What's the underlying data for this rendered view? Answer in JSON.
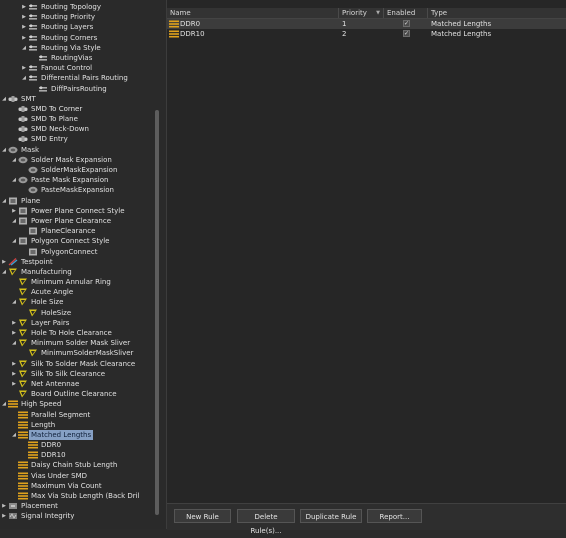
{
  "tree": [
    {
      "label": "Routing Topology",
      "icon": "rule-icon",
      "expander": "collapsed",
      "depth": 3
    },
    {
      "label": "Routing Priority",
      "icon": "rule-icon",
      "expander": "collapsed",
      "depth": 3
    },
    {
      "label": "Routing Layers",
      "icon": "rule-icon",
      "expander": "collapsed",
      "depth": 3
    },
    {
      "label": "Routing Corners",
      "icon": "rule-icon",
      "expander": "collapsed",
      "depth": 3
    },
    {
      "label": "Routing Via Style",
      "icon": "rule-icon",
      "expander": "expanded",
      "depth": 3
    },
    {
      "label": "RoutingVias",
      "icon": "rule-icon",
      "expander": "none",
      "depth": 4
    },
    {
      "label": "Fanout Control",
      "icon": "rule-icon",
      "expander": "collapsed",
      "depth": 3
    },
    {
      "label": "Differential Pairs Routing",
      "icon": "rule-icon",
      "expander": "expanded",
      "depth": 3
    },
    {
      "label": "DiffPairsRouting",
      "icon": "rule-icon",
      "expander": "none",
      "depth": 4
    },
    {
      "label": "SMT",
      "icon": "smt-icon",
      "expander": "expanded",
      "depth": 1
    },
    {
      "label": "SMD To Corner",
      "icon": "smt-icon",
      "expander": "none",
      "depth": 2
    },
    {
      "label": "SMD To Plane",
      "icon": "smt-icon",
      "expander": "none",
      "depth": 2
    },
    {
      "label": "SMD Neck-Down",
      "icon": "smt-icon",
      "expander": "none",
      "depth": 2
    },
    {
      "label": "SMD Entry",
      "icon": "smt-icon",
      "expander": "none",
      "depth": 2
    },
    {
      "label": "Mask",
      "icon": "mask-icon",
      "expander": "expanded",
      "depth": 1
    },
    {
      "label": "Solder Mask Expansion",
      "icon": "mask-icon",
      "expander": "expanded",
      "depth": 2
    },
    {
      "label": "SolderMaskExpansion",
      "icon": "mask-icon",
      "expander": "none",
      "depth": 3
    },
    {
      "label": "Paste Mask Expansion",
      "icon": "mask-icon",
      "expander": "expanded",
      "depth": 2
    },
    {
      "label": "PasteMaskExpansion",
      "icon": "mask-icon",
      "expander": "none",
      "depth": 3
    },
    {
      "label": "Plane",
      "icon": "plane-icon",
      "expander": "expanded",
      "depth": 1
    },
    {
      "label": "Power Plane Connect Style",
      "icon": "plane-icon",
      "expander": "collapsed",
      "depth": 2
    },
    {
      "label": "Power Plane Clearance",
      "icon": "plane-icon",
      "expander": "expanded",
      "depth": 2
    },
    {
      "label": "PlaneClearance",
      "icon": "plane-icon",
      "expander": "none",
      "depth": 3
    },
    {
      "label": "Polygon Connect Style",
      "icon": "plane-icon",
      "expander": "expanded",
      "depth": 2
    },
    {
      "label": "PolygonConnect",
      "icon": "plane-icon",
      "expander": "none",
      "depth": 3
    },
    {
      "label": "Testpoint",
      "icon": "testpoint-icon",
      "expander": "collapsed",
      "depth": 1
    },
    {
      "label": "Manufacturing",
      "icon": "manufacturing-icon",
      "expander": "expanded",
      "depth": 1
    },
    {
      "label": "Minimum Annular Ring",
      "icon": "manufacturing-icon",
      "expander": "none",
      "depth": 2
    },
    {
      "label": "Acute Angle",
      "icon": "manufacturing-icon",
      "expander": "none",
      "depth": 2
    },
    {
      "label": "Hole Size",
      "icon": "manufacturing-icon",
      "expander": "expanded",
      "depth": 2
    },
    {
      "label": "HoleSize",
      "icon": "manufacturing-icon",
      "expander": "none",
      "depth": 3
    },
    {
      "label": "Layer Pairs",
      "icon": "manufacturing-icon",
      "expander": "collapsed",
      "depth": 2
    },
    {
      "label": "Hole To Hole Clearance",
      "icon": "manufacturing-icon",
      "expander": "collapsed",
      "depth": 2
    },
    {
      "label": "Minimum Solder Mask Sliver",
      "icon": "manufacturing-icon",
      "expander": "expanded",
      "depth": 2
    },
    {
      "label": "MinimumSolderMaskSliver",
      "icon": "manufacturing-icon",
      "expander": "none",
      "depth": 3
    },
    {
      "label": "Silk To Solder Mask Clearance",
      "icon": "manufacturing-icon",
      "expander": "collapsed",
      "depth": 2
    },
    {
      "label": "Silk To Silk Clearance",
      "icon": "manufacturing-icon",
      "expander": "collapsed",
      "depth": 2
    },
    {
      "label": "Net Antennae",
      "icon": "manufacturing-icon",
      "expander": "collapsed",
      "depth": 2
    },
    {
      "label": "Board Outline Clearance",
      "icon": "manufacturing-icon",
      "expander": "none",
      "depth": 2
    },
    {
      "label": "High Speed",
      "icon": "highspeed-icon",
      "expander": "expanded",
      "depth": 1
    },
    {
      "label": "Parallel Segment",
      "icon": "highspeed-icon",
      "expander": "none",
      "depth": 2
    },
    {
      "label": "Length",
      "icon": "highspeed-icon",
      "expander": "none",
      "depth": 2
    },
    {
      "label": "Matched Lengths",
      "icon": "highspeed-icon",
      "expander": "expanded",
      "depth": 2,
      "selected": true
    },
    {
      "label": "DDR0",
      "icon": "highspeed-icon",
      "expander": "none",
      "depth": 3
    },
    {
      "label": "DDR10",
      "icon": "highspeed-icon",
      "expander": "none",
      "depth": 3
    },
    {
      "label": "Daisy Chain Stub Length",
      "icon": "highspeed-icon",
      "expander": "none",
      "depth": 2
    },
    {
      "label": "Vias Under SMD",
      "icon": "highspeed-icon",
      "expander": "none",
      "depth": 2
    },
    {
      "label": "Maximum Via Count",
      "icon": "highspeed-icon",
      "expander": "none",
      "depth": 2
    },
    {
      "label": "Max Via Stub Length (Back Dril",
      "icon": "highspeed-icon",
      "expander": "none",
      "depth": 2
    },
    {
      "label": "Placement",
      "icon": "placement-icon",
      "expander": "collapsed",
      "depth": 1
    },
    {
      "label": "Signal Integrity",
      "icon": "signal-icon",
      "expander": "collapsed",
      "depth": 1
    }
  ],
  "grid": {
    "columns": [
      {
        "label": "Name"
      },
      {
        "label": "Priority"
      },
      {
        "label": "Enabled"
      },
      {
        "label": "Type"
      }
    ],
    "rows": [
      {
        "name": "DDR0",
        "priority": "1",
        "enabled": true,
        "type": "Matched Lengths",
        "selected": true
      },
      {
        "name": "DDR10",
        "priority": "2",
        "enabled": true,
        "type": "Matched Lengths",
        "selected": false
      }
    ]
  },
  "buttons": {
    "new_rule": "New Rule",
    "delete_rule": "Delete Rule(s)...",
    "duplicate_rule": "Duplicate Rule",
    "report": "Report..."
  },
  "colors": {
    "selection": "#86a0c4",
    "highspeed": "#e0a21c",
    "manufacturing": "#d6c21a",
    "mask": "#9a9a9a",
    "plane": "#b0b0b0"
  }
}
